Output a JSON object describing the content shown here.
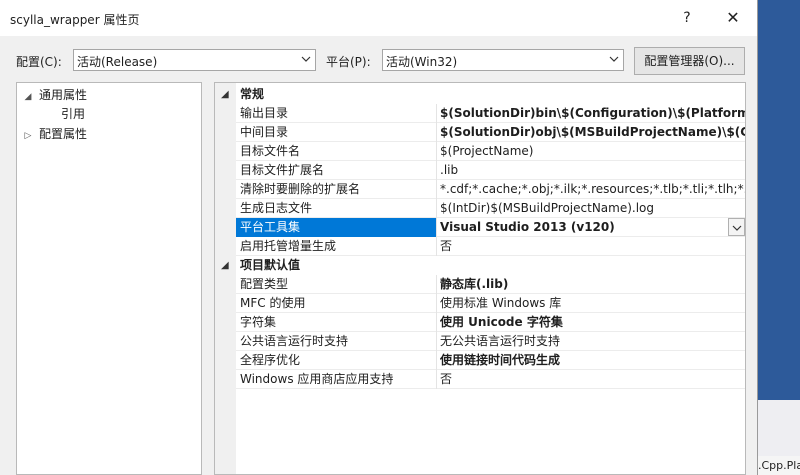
{
  "window": {
    "title": "scylla_wrapper 属性页",
    "help_glyph": "?",
    "close_glyph": "✕"
  },
  "config_bar": {
    "config_label": "配置(C):",
    "config_value": "活动(Release)",
    "platform_label": "平台(P):",
    "platform_value": "活动(Win32)",
    "manager_button": "配置管理器(O)..."
  },
  "tree": {
    "items": [
      {
        "label": "通用属性",
        "expander": "◢"
      },
      {
        "label": "引用"
      },
      {
        "label": "配置属性",
        "expander": "▷"
      }
    ]
  },
  "grid": {
    "sections": [
      {
        "title": "常规",
        "expander": "◢"
      },
      {
        "title": "项目默认值",
        "expander": "◢"
      }
    ],
    "rows": [
      {
        "name": "输出目录",
        "value": "$(SolutionDir)bin\\$(Configuration)\\$(Platform)\\"
      },
      {
        "name": "中间目录",
        "value": "$(SolutionDir)obj\\$(MSBuildProjectName)\\$(Configuration)\\"
      },
      {
        "name": "目标文件名",
        "value": "$(ProjectName)"
      },
      {
        "name": "目标文件扩展名",
        "value": ".lib"
      },
      {
        "name": "清除时要删除的扩展名",
        "value": "*.cdf;*.cache;*.obj;*.ilk;*.resources;*.tlb;*.tli;*.tlh;*.tmp;*.rsp"
      },
      {
        "name": "生成日志文件",
        "value": "$(IntDir)$(MSBuildProjectName).log"
      },
      {
        "name": "平台工具集",
        "value": "Visual Studio 2013 (v120)"
      },
      {
        "name": "启用托管增量生成",
        "value": "否"
      },
      {
        "name": "配置类型",
        "value": "静态库(.lib)"
      },
      {
        "name": "MFC 的使用",
        "value": "使用标准 Windows 库"
      },
      {
        "name": "字符集",
        "value": "使用 Unicode 字符集"
      },
      {
        "name": "公共语言运行时支持",
        "value": "无公共语言运行时支持"
      },
      {
        "name": "全程序优化",
        "value": "使用链接时间代码生成"
      },
      {
        "name": "Windows 应用商店应用支持",
        "value": "否"
      }
    ]
  },
  "background": {
    "tab_text": ".Cpp.Pla"
  }
}
